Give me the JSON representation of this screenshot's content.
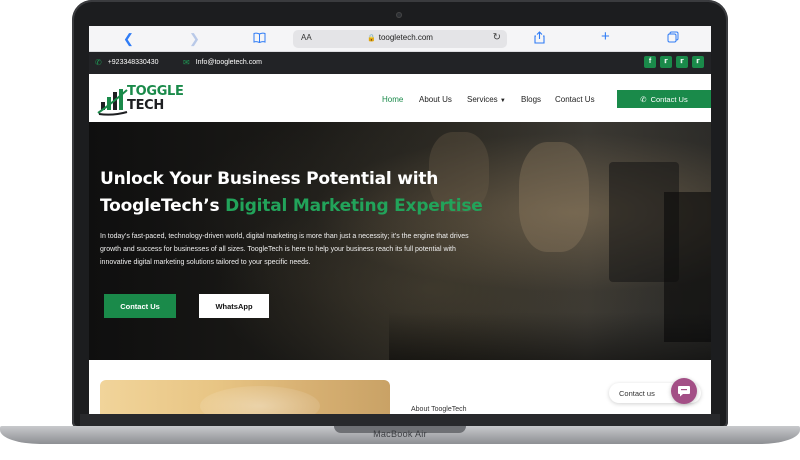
{
  "browser": {
    "url": "toogletech.com",
    "text_size_label": "AA"
  },
  "topbar": {
    "phone": "+923348330430",
    "email": "Info@toogletech.com",
    "social": [
      "facebook",
      "twitter",
      "twitter",
      "twitter"
    ]
  },
  "logo": {
    "line1": "TOGGLE",
    "line2": "TECH"
  },
  "nav": {
    "items": [
      "Home",
      "About Us",
      "Services",
      "Blogs",
      "Contact Us"
    ],
    "active": "Home",
    "cta": "Contact Us"
  },
  "hero": {
    "title_line1": "Unlock Your Business Potential with",
    "title_line2_plain": "ToogleTech’s ",
    "title_line2_accent": "Digital Marketing Expertise",
    "paragraph": "In today’s fast-paced, technology-driven world, digital marketing is more than just a necessity; it’s the engine that drives growth and success for businesses of all sizes. ToogleTech is here to help your business reach its full potential with innovative digital marketing solutions tailored to your specific needs.",
    "primary_button": "Contact Us",
    "secondary_button": "WhatsApp"
  },
  "about": {
    "label": "About ToogleTech"
  },
  "chat_widget": {
    "label": "Contact us"
  },
  "device": {
    "label": "MacBook Air"
  },
  "colors": {
    "brand_green": "#1a8a4a",
    "accent_green": "#22a35a",
    "topbar": "#222326",
    "chat": "#a34f86"
  }
}
